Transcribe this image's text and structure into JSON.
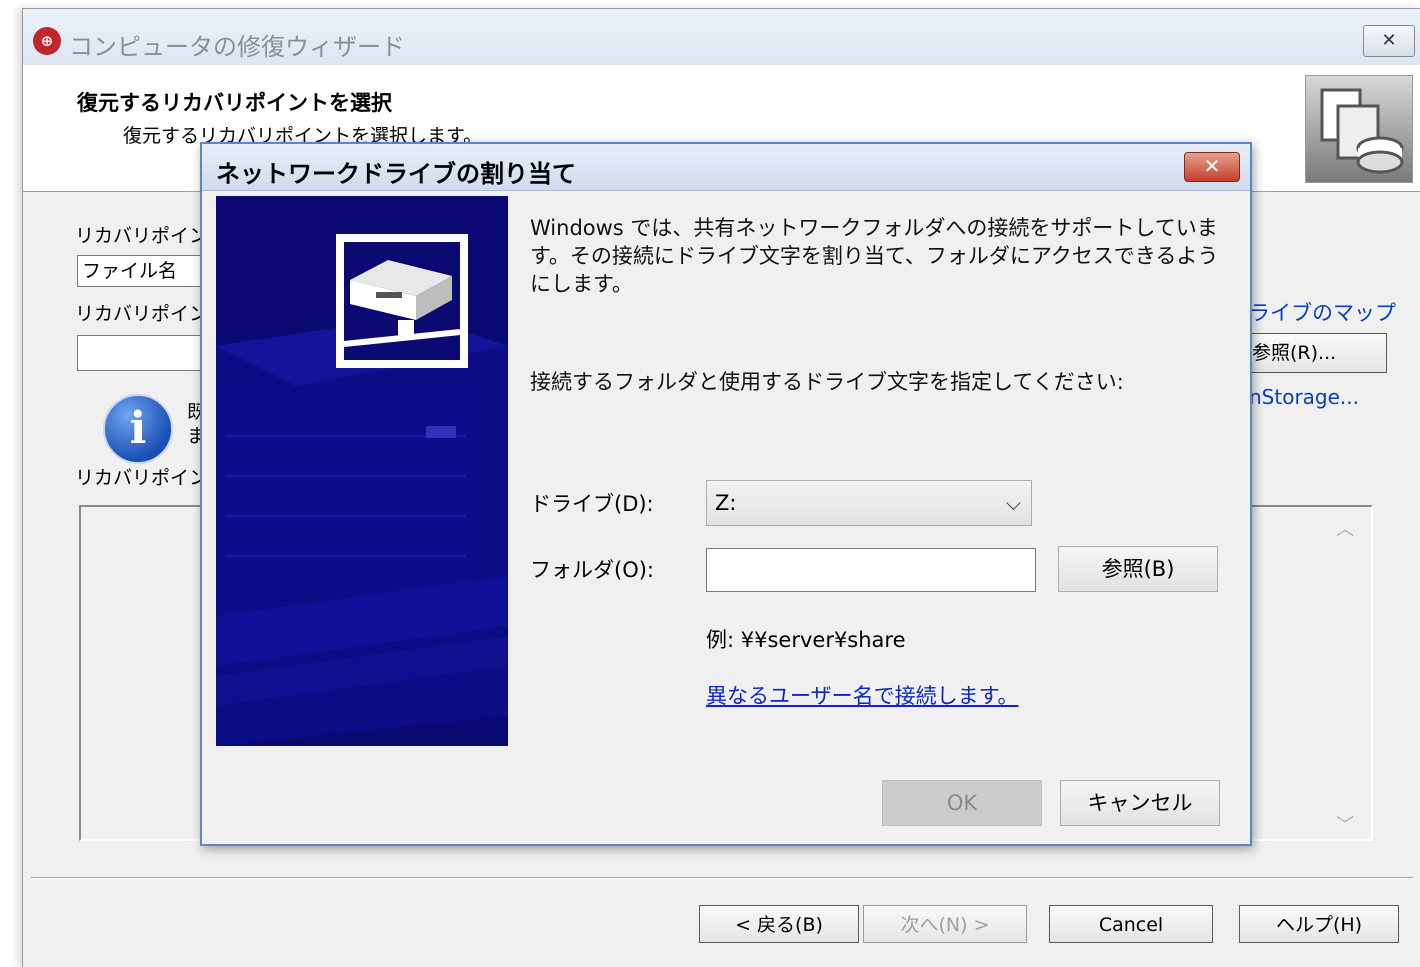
{
  "wizard": {
    "app_icon": "recovery-app-icon",
    "title": "コンピュータの修復ウィザード",
    "close_icon": "close-icon",
    "header_title": "復元するリカバリポイントを選択",
    "header_subtitle": "復元するリカバリポイントを選択します。",
    "recovery_point_label": "リカバリポイント",
    "filename_field": "ファイル名",
    "recovery_point_label2": "リカバリポイント",
    "info_chars": "既",
    "info_chars2": "ま",
    "recovery_point_label3": "リカバリポイント",
    "link_drive_map": "ライブのマップ",
    "browse_partial": "参照(R)...",
    "link_storage": "nStorage...",
    "buttons": {
      "back": "< 戻る(B)",
      "next": "次へ(N) >",
      "cancel": "Cancel",
      "help": "ヘルプ(H)"
    }
  },
  "dialog": {
    "title": "ネットワークドライブの割り当て",
    "intro": "Windows では、共有ネットワークフォルダへの接続をサポートしています。その接続にドライブ文字を割り当て、フォルダにアクセスできるようにします。",
    "prompt": "接続するフォルダと使用するドライブ文字を指定してください:",
    "drive_label": "ドライブ(D):",
    "drive_value": "Z:",
    "folder_label": "フォルダ(O):",
    "folder_value": "",
    "browse_button": "参照(B)",
    "example": "例: ¥¥server¥share",
    "alt_user_link": "異なるユーザー名で接続します。",
    "ok_button": "OK",
    "cancel_button": "キャンセル"
  }
}
